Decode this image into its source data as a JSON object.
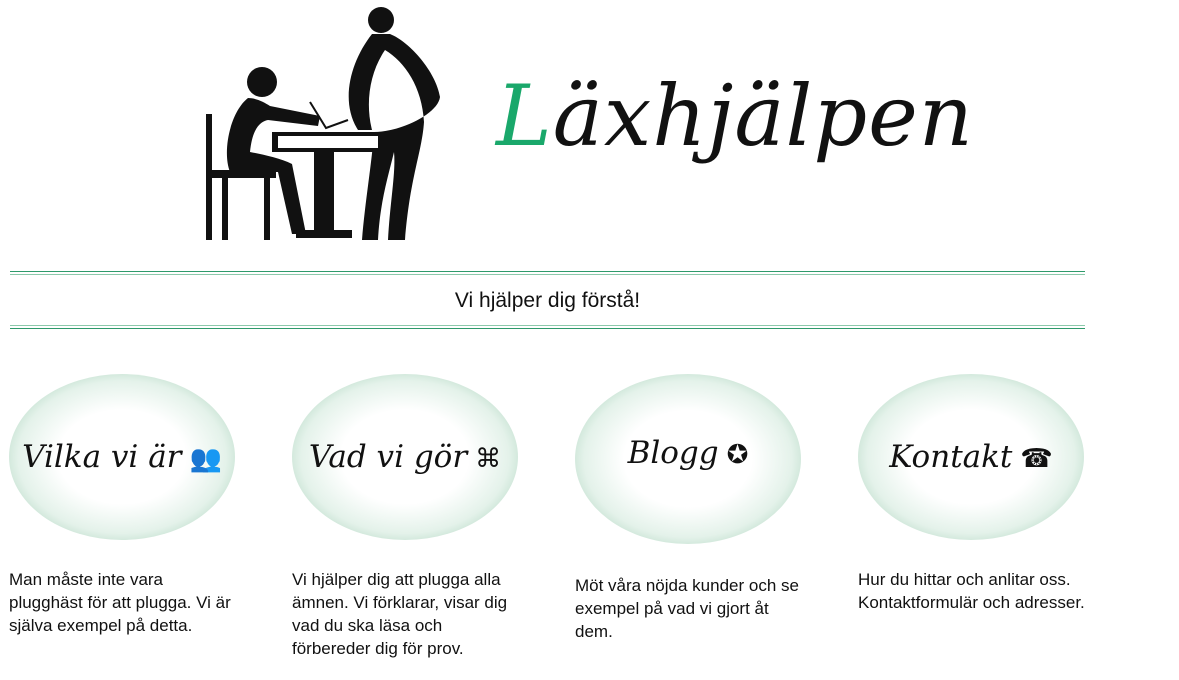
{
  "header": {
    "title_first_letter": "L",
    "title_rest": "äxhjälpen",
    "accent_color": "#1aa86b"
  },
  "tagline": "Vi hjälper dig förstå!",
  "cards": [
    {
      "label": "Vilka vi är",
      "icon": "persons-icon",
      "icon_glyph": "👥",
      "text": "Man måste inte vara plugghäst för att plugga. Vi är själva exempel på detta."
    },
    {
      "label": "Vad vi gör",
      "icon": "command-icon",
      "icon_glyph": "⌘",
      "text": "Vi hjälper dig att plugga alla ämnen. Vi förklarar, visar dig vad du ska läsa och förbereder dig för prov."
    },
    {
      "label": "Blogg",
      "icon": "star-icon",
      "icon_glyph": "✪",
      "text": "Möt våra nöjda kunder och se exempel på vad vi gjort åt dem."
    },
    {
      "label": "Kontakt",
      "icon": "phone-icon",
      "icon_glyph": "☎",
      "text": "Hur du hittar och anlitar oss. Kontaktformulär och adresser."
    }
  ]
}
